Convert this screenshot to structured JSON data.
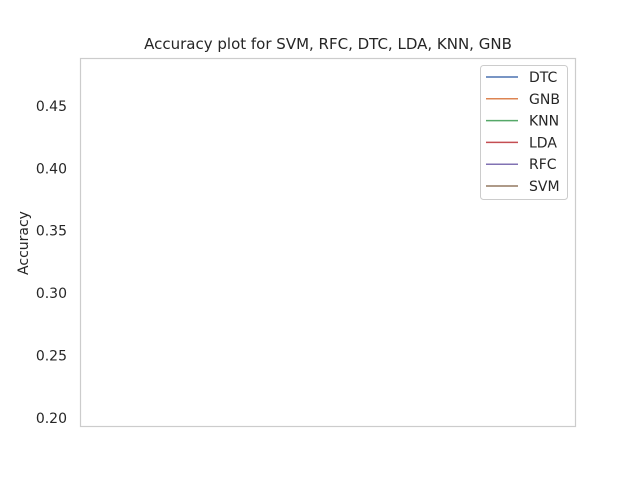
{
  "chart_data": {
    "type": "line",
    "title": "Accuracy plot  for SVM, RFC, DTC, LDA, KNN, GNB",
    "xlabel": "",
    "ylabel": "Accuracy",
    "ylim": [
      0.193,
      0.488
    ],
    "yticks": [
      "0.20",
      "0.25",
      "0.30",
      "0.35",
      "0.40",
      "0.45"
    ],
    "grid": false,
    "legend_position": "top-right",
    "series": [
      {
        "name": "DTC",
        "color": "#4c72b0",
        "values": []
      },
      {
        "name": "GNB",
        "color": "#dd8452",
        "values": []
      },
      {
        "name": "KNN",
        "color": "#55a868",
        "values": []
      },
      {
        "name": "LDA",
        "color": "#c44e52",
        "values": []
      },
      {
        "name": "RFC",
        "color": "#8172b3",
        "values": []
      },
      {
        "name": "SVM",
        "color": "#937860",
        "values": []
      }
    ]
  }
}
